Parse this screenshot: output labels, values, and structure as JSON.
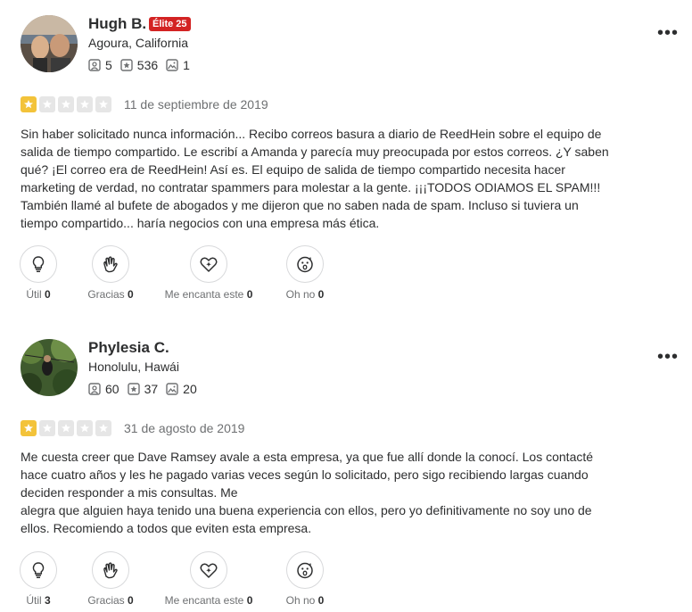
{
  "reviews": [
    {
      "user": {
        "name": "Hugh B.",
        "badge": "Élite 25",
        "location": "Agoura, California",
        "friends": "5",
        "reviews": "536",
        "photos": "1"
      },
      "rating": 1,
      "date": "11 de septiembre de 2019",
      "text": [
        "Sin haber solicitado nunca información... Recibo correos basura a diario de ReedHein sobre el equipo de salida de tiempo compartido. Le escribí a Amanda y parecía muy preocupada por estos correos. ¿Y saben qué? ¡El correo era de ReedHein! Así es. El equipo de salida de tiempo compartido necesita hacer marketing de verdad, no contratar spammers para molestar a la gente. ¡¡¡TODOS ODIAMOS EL SPAM!!! También llamé al bufete de abogados y me dijeron que no saben nada de spam. Incluso si tuviera un tiempo compartido... haría negocios con una empresa más ética."
      ],
      "reactions": [
        {
          "label": "Útil",
          "count": "0"
        },
        {
          "label": "Gracias",
          "count": "0"
        },
        {
          "label": "Me encanta este",
          "count": "0"
        },
        {
          "label": "Oh no",
          "count": "0"
        }
      ]
    },
    {
      "user": {
        "name": "Phylesia C.",
        "location": "Honolulu, Hawái",
        "friends": "60",
        "reviews": "37",
        "photos": "20"
      },
      "rating": 1,
      "date": "31 de agosto de 2019",
      "text": [
        "Me cuesta creer que Dave Ramsey avale a esta empresa, ya que fue allí donde la conocí. Los contacté hace cuatro años y les he pagado varias veces según lo solicitado, pero sigo recibiendo largas cuando deciden responder a mis consultas. Me",
        "alegra que alguien haya tenido una buena experiencia con ellos, pero yo definitivamente no soy uno de ellos. Recomiendo a todos que eviten esta empresa."
      ],
      "reactions": [
        {
          "label": "Útil",
          "count": "3"
        },
        {
          "label": "Gracias",
          "count": "0"
        },
        {
          "label": "Me encanta este",
          "count": "0"
        },
        {
          "label": "Oh no",
          "count": "0"
        }
      ]
    }
  ],
  "more_label": "•••",
  "colors": {
    "elite": "#d32323",
    "star_on": "#f3c33a",
    "star_off": "#e6e6e6"
  }
}
